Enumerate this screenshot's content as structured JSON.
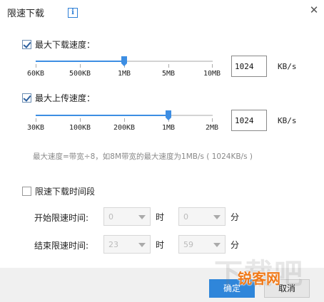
{
  "dialog": {
    "title": "限速下载",
    "info_glyph": "i",
    "close_glyph": "✕"
  },
  "download": {
    "checked": true,
    "label": "最大下载速度：",
    "ticks": [
      "60KB",
      "500KB",
      "1MB",
      "5MB",
      "10MB"
    ],
    "value_fraction": 0.5,
    "input_value": "1024",
    "unit": "KB/s"
  },
  "upload": {
    "checked": true,
    "label": "最大上传速度：",
    "ticks": [
      "30KB",
      "100KB",
      "200KB",
      "1MB",
      "2MB"
    ],
    "value_fraction": 0.75,
    "input_value": "1024",
    "unit": "KB/s"
  },
  "note": "最大速度=带宽÷8，如8M带宽的最大速度为1MB/s ( 1024KB/s )",
  "schedule": {
    "checked": false,
    "label": "限速下载时间段",
    "start": {
      "label": "开始限速时间:",
      "hour": "0",
      "hour_unit": "时",
      "minute": "0",
      "minute_unit": "分"
    },
    "end": {
      "label": "结束限速时间:",
      "hour": "23",
      "hour_unit": "时",
      "minute": "59",
      "minute_unit": "分"
    }
  },
  "footer": {
    "ok_label": "确定",
    "cancel_label": "取消"
  },
  "watermark": {
    "big_text": "下载吧",
    "logo_text": "锐客网"
  },
  "colors": {
    "accent": "#3d8ee3",
    "button_primary": "#2f86da"
  }
}
